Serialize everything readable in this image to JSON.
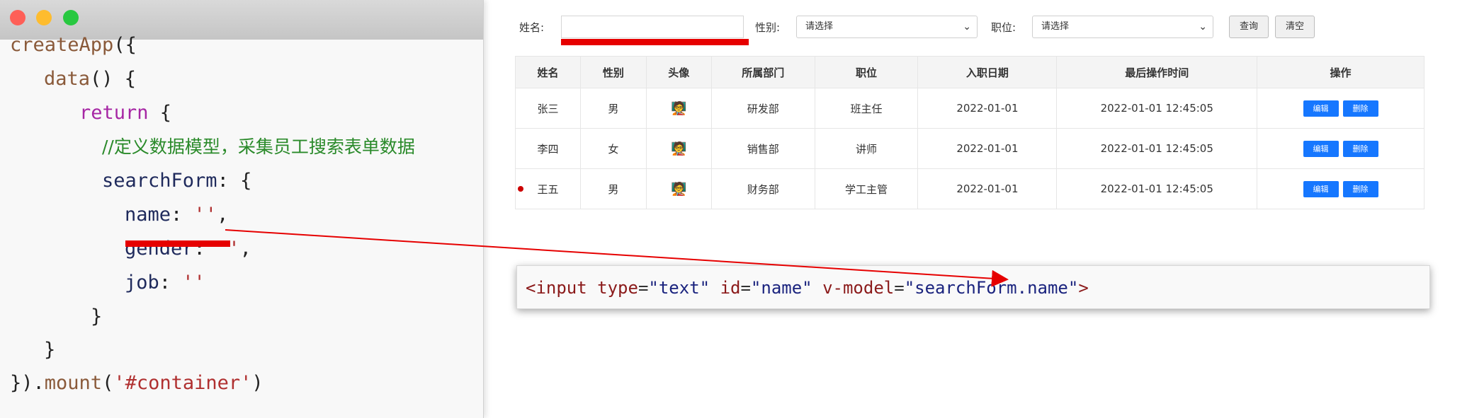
{
  "code_window": {
    "lines": [
      {
        "parts": [
          {
            "t": "createApp",
            "c": "fn"
          },
          {
            "t": "({",
            "c": "punc"
          }
        ]
      },
      {
        "parts": [
          {
            "t": "data",
            "c": "fn"
          },
          {
            "t": "() {",
            "c": "punc"
          }
        ]
      },
      {
        "parts": [
          {
            "t": "return",
            "c": "kw"
          },
          {
            "t": " {",
            "c": "punc"
          }
        ]
      },
      {
        "parts": [
          {
            "t": "//定义数据模型，采集员工搜索表单数据",
            "c": "cm"
          }
        ]
      },
      {
        "parts": [
          {
            "t": "searchForm",
            "c": "prop"
          },
          {
            "t": ": {",
            "c": "punc"
          }
        ]
      },
      {
        "parts": [
          {
            "t": "name",
            "c": "prop"
          },
          {
            "t": ": ",
            "c": "punc"
          },
          {
            "t": "''",
            "c": "str"
          },
          {
            "t": ",",
            "c": "punc"
          }
        ]
      },
      {
        "parts": [
          {
            "t": "gender",
            "c": "prop"
          },
          {
            "t": ": ",
            "c": "punc"
          },
          {
            "t": "''",
            "c": "str"
          },
          {
            "t": ",",
            "c": "punc"
          }
        ]
      },
      {
        "parts": [
          {
            "t": "job",
            "c": "prop"
          },
          {
            "t": ": ",
            "c": "punc"
          },
          {
            "t": "''",
            "c": "str"
          }
        ]
      },
      {
        "parts": [
          {
            "t": "}",
            "c": "punc"
          }
        ]
      },
      {
        "parts": [
          {
            "t": "}",
            "c": "punc"
          }
        ]
      },
      {
        "parts": [
          {
            "t": "}).",
            "c": "punc"
          },
          {
            "t": "mount",
            "c": "fn"
          },
          {
            "t": "(",
            "c": "punc"
          },
          {
            "t": "'#container'",
            "c": "str"
          },
          {
            "t": ")",
            "c": "punc"
          }
        ]
      }
    ]
  },
  "search_form": {
    "name_label": "姓名:",
    "name_value": "",
    "gender_label": "性别:",
    "gender_selected": "请选择",
    "job_label": "职位:",
    "job_selected": "请选择",
    "query_button": "查询",
    "clear_button": "清空"
  },
  "table": {
    "columns": [
      "姓名",
      "性别",
      "头像",
      "所属部门",
      "职位",
      "入职日期",
      "最后操作时间",
      "操作"
    ],
    "rows": [
      {
        "name": "张三",
        "gender": "男",
        "avatar": "🧑‍🏫",
        "dept": "研发部",
        "job": "班主任",
        "entry_date": "2022-01-01",
        "last_op": "2022-01-01 12:45:05"
      },
      {
        "name": "李四",
        "gender": "女",
        "avatar": "🧑‍🏫",
        "dept": "销售部",
        "job": "讲师",
        "entry_date": "2022-01-01",
        "last_op": "2022-01-01 12:45:05"
      },
      {
        "name": "王五",
        "gender": "男",
        "avatar": "🧑‍🏫",
        "dept": "财务部",
        "job": "学工主管",
        "entry_date": "2022-01-01",
        "last_op": "2022-01-01 12:45:05"
      }
    ],
    "edit_label": "编辑",
    "delete_label": "删除"
  },
  "snippet": {
    "parts": [
      {
        "t": "<input",
        "c": "tag"
      },
      {
        "t": " ",
        "c": "punc"
      },
      {
        "t": "type",
        "c": "attr"
      },
      {
        "t": "=",
        "c": "punc"
      },
      {
        "t": "\"text\"",
        "c": "val"
      },
      {
        "t": " ",
        "c": "punc"
      },
      {
        "t": "id",
        "c": "attr"
      },
      {
        "t": "=",
        "c": "punc"
      },
      {
        "t": "\"name\"",
        "c": "val"
      },
      {
        "t": " ",
        "c": "punc"
      },
      {
        "t": "v-model",
        "c": "attr"
      },
      {
        "t": "=",
        "c": "punc"
      },
      {
        "t": "\"searchForm.name\"",
        "c": "val"
      },
      {
        "t": ">",
        "c": "tag"
      }
    ]
  },
  "colors": {
    "accent_red": "#e60000",
    "button_blue": "#1677ff"
  }
}
